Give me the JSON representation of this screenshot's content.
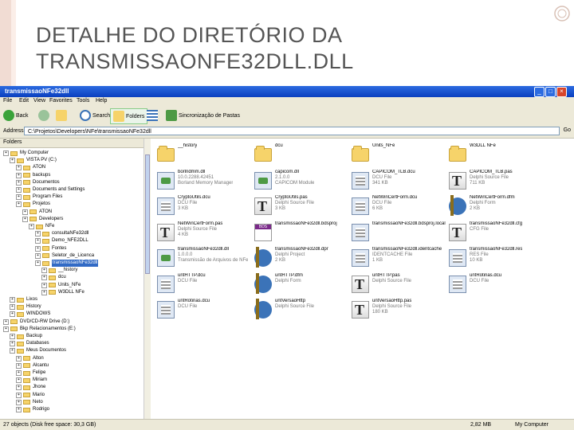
{
  "slide": {
    "title": "DETALHE DO DIRETÓRIO DA TRANSMISSAONFE32DLL.DLL"
  },
  "window": {
    "title": "transmissaoNFe32dll",
    "menu": [
      "File",
      "Edit",
      "View",
      "Favorites",
      "Tools",
      "Help"
    ],
    "toolbar": {
      "back": "Back",
      "search": "Search",
      "folders": "Folders",
      "sync": "Sincronização de Pastas"
    },
    "address": {
      "label": "Address",
      "path": "C:\\Projetos\\Developers\\NFe\\transmissaoNFe32dll",
      "go": "Go"
    },
    "folders_pane": {
      "title": "Folders",
      "close": "x"
    },
    "tree": [
      {
        "label": "My Computer",
        "indent": 0
      },
      {
        "label": "VISTA PV (C:)",
        "indent": 1
      },
      {
        "label": "ATON",
        "indent": 2
      },
      {
        "label": "backups",
        "indent": 2
      },
      {
        "label": "Documentos",
        "indent": 2
      },
      {
        "label": "Documents and Settings",
        "indent": 2
      },
      {
        "label": "Program Files",
        "indent": 2
      },
      {
        "label": "Projetos",
        "indent": 2
      },
      {
        "label": "ATON",
        "indent": 3
      },
      {
        "label": "Developers",
        "indent": 3
      },
      {
        "label": "NFe",
        "indent": 4
      },
      {
        "label": "consultaNFe32dll",
        "indent": 5
      },
      {
        "label": "Demo_NFE2DLL",
        "indent": 5
      },
      {
        "label": "Fontes",
        "indent": 5
      },
      {
        "label": "Seletor_de_Licenca",
        "indent": 5
      },
      {
        "label": "transmissaoNFe32dll",
        "indent": 5,
        "selected": true
      },
      {
        "label": "__history",
        "indent": 6
      },
      {
        "label": "dcu",
        "indent": 6
      },
      {
        "label": "Units_NFe",
        "indent": 6
      },
      {
        "label": "W3DLL NFe",
        "indent": 6
      },
      {
        "label": "Lixos",
        "indent": 1
      },
      {
        "label": "History",
        "indent": 1
      },
      {
        "label": "WINDOWS",
        "indent": 1
      },
      {
        "label": "DVD/CD-RW Drive (D:)",
        "indent": 0
      },
      {
        "label": "Bkp Relacionamentos (E:)",
        "indent": 0
      },
      {
        "label": "Backup",
        "indent": 1
      },
      {
        "label": "Databases",
        "indent": 1
      },
      {
        "label": "Meus Documentos",
        "indent": 1
      },
      {
        "label": "Alton",
        "indent": 2
      },
      {
        "label": "Alcantu",
        "indent": 2
      },
      {
        "label": "Felipe",
        "indent": 2
      },
      {
        "label": "Miriam",
        "indent": 2
      },
      {
        "label": "Jhone",
        "indent": 2
      },
      {
        "label": "Mario",
        "indent": 2
      },
      {
        "label": "Neto",
        "indent": 2
      },
      {
        "label": "Rodrigo",
        "indent": 2
      }
    ],
    "files": [
      {
        "name": "__history",
        "meta1": "",
        "meta2": "",
        "kind": "folder"
      },
      {
        "name": "dcu",
        "meta1": "",
        "meta2": "",
        "kind": "folder"
      },
      {
        "name": "Units_NFe",
        "meta1": "",
        "meta2": "",
        "kind": "folder"
      },
      {
        "name": "W3DLL NFe",
        "meta1": "",
        "meta2": "",
        "kind": "folder"
      },
      {
        "name": "borlndmm.dll",
        "meta1": "10.0.2288.42451",
        "meta2": "Borland Memory Manager",
        "kind": "dll"
      },
      {
        "name": "capicom.dll",
        "meta1": "2.1.0.0",
        "meta2": "CAPICOM Module",
        "kind": "dll"
      },
      {
        "name": "CAPICOM_TLB.dcu",
        "meta1": "DCU File",
        "meta2": "341 KB",
        "kind": "res"
      },
      {
        "name": "CAPICOM_TLB.pas",
        "meta1": "Delphi Source File",
        "meta2": "711 KB",
        "kind": "pas"
      },
      {
        "name": "CryptoUtils.dcu",
        "meta1": "DCU File",
        "meta2": "3 KB",
        "kind": "res"
      },
      {
        "name": "CryptoUtils.pas",
        "meta1": "Delphi Source File",
        "meta2": "3 KB",
        "kind": "pas"
      },
      {
        "name": "NetWinCertForm.dcu",
        "meta1": "DCU File",
        "meta2": "6 KB",
        "kind": "res"
      },
      {
        "name": "NetWinCertForm.dfm",
        "meta1": "Delphi Form",
        "meta2": "2 KB",
        "kind": "dfm"
      },
      {
        "name": "NetWinCertForm.pas",
        "meta1": "Delphi Source File",
        "meta2": "4 KB",
        "kind": "pas"
      },
      {
        "name": "transmissaoNFe32dll.bdsproj",
        "meta1": "",
        "meta2": "",
        "kind": "bds"
      },
      {
        "name": "transmissaoNFe32dll.bdsproj.local",
        "meta1": "",
        "meta2": "",
        "kind": "res"
      },
      {
        "name": "transmissaoNFe32dll.cfg",
        "meta1": "CFG File",
        "meta2": "",
        "kind": "pas"
      },
      {
        "name": "transmissaoNFe32dll.dll",
        "meta1": "1.0.0.0",
        "meta2": "Transmissão de Arquivos de NFe",
        "kind": "dll"
      },
      {
        "name": "transmissaoNFe32dll.dpr",
        "meta1": "Delphi Project",
        "meta2": "2 KB",
        "kind": "dfm"
      },
      {
        "name": "transmissaoNFe32dll.identcache",
        "meta1": "IDENTCACHE File",
        "meta2": "1 KB",
        "kind": "res"
      },
      {
        "name": "transmissaoNFe32dll.res",
        "meta1": "RES File",
        "meta2": "10 KB",
        "kind": "res"
      },
      {
        "name": "untHTTP.dcu",
        "meta1": "DCU File",
        "meta2": "",
        "kind": "res"
      },
      {
        "name": "untHTTP.dfm",
        "meta1": "Delphi Form",
        "meta2": "",
        "kind": "dfm"
      },
      {
        "name": "untHTTP.pas",
        "meta1": "Delphi Source File",
        "meta2": "",
        "kind": "pas"
      },
      {
        "name": "untRotinas.dcu",
        "meta1": "DCU File",
        "meta2": "",
        "kind": "res"
      },
      {
        "name": "untRotinas.dcu",
        "meta1": "DCU File",
        "meta2": "",
        "kind": "res"
      },
      {
        "name": "untVersaoHttp",
        "meta1": "Delphi Source File",
        "meta2": "",
        "kind": "dfm"
      },
      {
        "name": "untVersaoHttp.pas",
        "meta1": "Delphi Source File",
        "meta2": "180 KB",
        "kind": "pas"
      }
    ],
    "status": {
      "left": "27 objects (Disk free space: 30,3 GB)",
      "size": "2,82 MB",
      "location": "My Computer"
    }
  }
}
